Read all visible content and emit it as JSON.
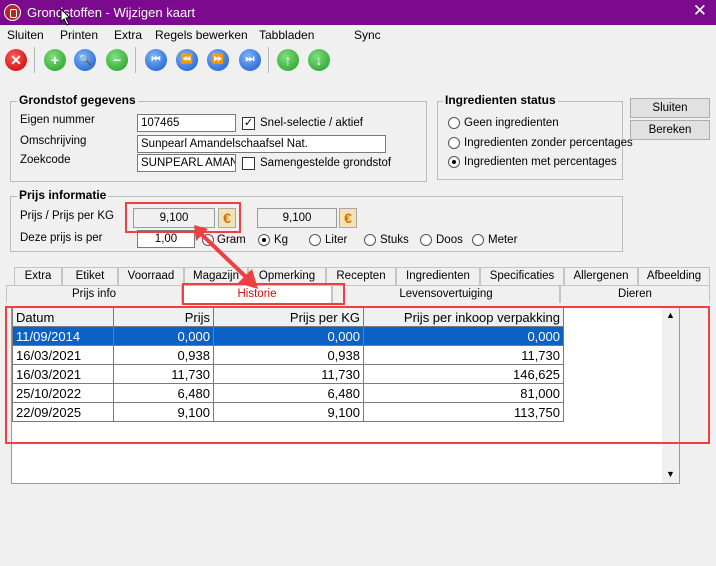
{
  "window": {
    "title": "Grondstoffen - Wijzigen kaart",
    "close_label": "✕"
  },
  "menu": [
    "Sluiten",
    "Printen",
    "Extra",
    "Regels bewerken",
    "Tabbladen",
    "Sync"
  ],
  "toolbar": {
    "close_glyph": "✕",
    "add_glyph": "+",
    "search_glyph": "🔍",
    "remove_glyph": "−",
    "first_glyph": "⏮",
    "prev_glyph": "⏪",
    "next_glyph": "⏩",
    "last_glyph": "⏭",
    "up_glyph": "↑",
    "down_glyph": "↓"
  },
  "grondstof": {
    "title": "Grondstof gegevens",
    "eigen_nummer_label": "Eigen nummer",
    "eigen_nummer": "107465",
    "snel_selectie_label": "Snel-selectie  / aktief",
    "snel_selectie_checked": "✓",
    "omschrijving_label": "Omschrijving",
    "omschrijving": "Sunpearl Amandelschaafsel Nat.",
    "zoekcode_label": "Zoekcode",
    "zoekcode": "SUNPEARL AMANDI",
    "samengestelde_label": "Samengestelde grondstof"
  },
  "status": {
    "title": "Ingredienten status",
    "options": [
      "Geen ingredienten",
      "Ingredienten zonder percentages",
      "Ingredienten met percentages"
    ],
    "selected_index": 2
  },
  "buttons": {
    "sluiten": "Sluiten",
    "bereken": "Bereken"
  },
  "prijs": {
    "title": "Prijs informatie",
    "prijs_label": "Prijs / Prijs per KG",
    "prijs_value": "9,100",
    "prijs_per_kg_value": "9,100",
    "euro_glyph": "€",
    "deze_prijs_label": "Deze prijs is per",
    "per_value": "1,00",
    "units": [
      "Gram",
      "Kg",
      "Liter",
      "Stuks",
      "Doos",
      "Meter"
    ],
    "unit_selected": "Kg"
  },
  "tabs_row1": [
    "Extra",
    "Etiket",
    "Voorraad",
    "Magazijn",
    "Opmerking",
    "Recepten",
    "Ingredienten",
    "Specificaties",
    "Allergenen",
    "Afbeelding"
  ],
  "tabs_row2": [
    "Prijs info",
    "Historie",
    "Levensovertuiging",
    "Dieren"
  ],
  "active_tab": "Historie",
  "table": {
    "columns": [
      "Datum",
      "Prijs",
      "Prijs per KG",
      "Prijs per inkoop verpakking"
    ],
    "rows": [
      [
        "11/09/2014",
        "0,000",
        "0,000",
        "0,000"
      ],
      [
        "16/03/2021",
        "0,938",
        "0,938",
        "11,730"
      ],
      [
        "16/03/2021",
        "11,730",
        "11,730",
        "146,625"
      ],
      [
        "25/10/2022",
        "6,480",
        "6,480",
        "81,000"
      ],
      [
        "22/09/2025",
        "9,100",
        "9,100",
        "113,750"
      ]
    ],
    "selected_row": 0
  },
  "colors": {
    "titlebar": "#7b0a8f",
    "selection": "#0b62c4",
    "highlight": "#ee4040"
  }
}
